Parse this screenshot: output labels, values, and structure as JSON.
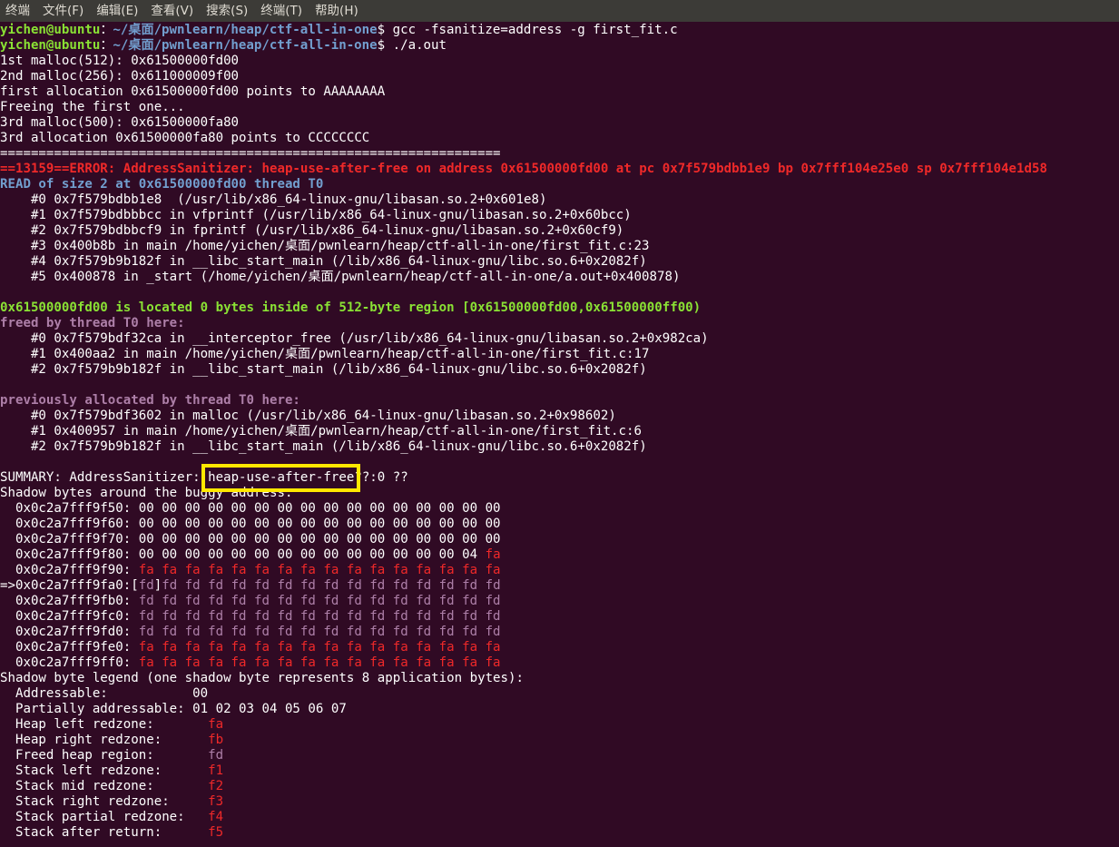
{
  "menubar": [
    "终端",
    "文件(F)",
    "编辑(E)",
    "查看(V)",
    "搜索(S)",
    "终端(T)",
    "帮助(H)"
  ],
  "colors": {
    "background": "#300a24",
    "prompt_user": "#8ae234",
    "prompt_path": "#729fcf",
    "error": "#ef2929",
    "note": "#ad7fa8",
    "highlight_box": "#ffe800"
  },
  "terminal_lines": [
    [
      [
        "g",
        "yichen@ubuntu"
      ],
      [
        "",
        "："
      ],
      [
        "b",
        "~/桌面/pwnlearn/heap/ctf-all-in-one"
      ],
      [
        "",
        "$ gcc -fsanitize=address -g first_fit.c"
      ]
    ],
    [
      [
        "g",
        "yichen@ubuntu"
      ],
      [
        "",
        "："
      ],
      [
        "b",
        "~/桌面/pwnlearn/heap/ctf-all-in-one"
      ],
      [
        "",
        "$ ./a.out"
      ]
    ],
    [
      [
        "",
        "1st malloc(512): 0x61500000fd00"
      ]
    ],
    [
      [
        "",
        "2nd malloc(256): 0x611000009f00"
      ]
    ],
    [
      [
        "",
        "first allocation 0x61500000fd00 points to AAAAAAAA"
      ]
    ],
    [
      [
        "",
        "Freeing the first one..."
      ]
    ],
    [
      [
        "",
        "3rd malloc(500): 0x61500000fa80"
      ]
    ],
    [
      [
        "",
        "3rd allocation 0x61500000fa80 points to CCCCCCCC"
      ]
    ],
    [
      [
        "",
        "================================================================="
      ]
    ],
    [
      [
        "r",
        "==13159==ERROR: AddressSanitizer: heap-use-after-free on address 0x61500000fd00 at pc 0x7f579bdbb1e9 bp 0x7fff104e25e0 sp 0x7fff104e1d58"
      ]
    ],
    [
      [
        "b",
        "READ of size 2 at 0x61500000fd00 thread T0"
      ]
    ],
    [
      [
        "",
        "    #0 0x7f579bdbb1e8  (/usr/lib/x86_64-linux-gnu/libasan.so.2+0x601e8)"
      ]
    ],
    [
      [
        "",
        "    #1 0x7f579bdbbbcc in vfprintf (/usr/lib/x86_64-linux-gnu/libasan.so.2+0x60bcc)"
      ]
    ],
    [
      [
        "",
        "    #2 0x7f579bdbbcf9 in fprintf (/usr/lib/x86_64-linux-gnu/libasan.so.2+0x60cf9)"
      ]
    ],
    [
      [
        "",
        "    #3 0x400b8b in main /home/yichen/桌面/pwnlearn/heap/ctf-all-in-one/first_fit.c:23"
      ]
    ],
    [
      [
        "",
        "    #4 0x7f579b9b182f in __libc_start_main (/lib/x86_64-linux-gnu/libc.so.6+0x2082f)"
      ]
    ],
    [
      [
        "",
        "    #5 0x400878 in _start (/home/yichen/桌面/pwnlearn/heap/ctf-all-in-one/a.out+0x400878)"
      ]
    ],
    [
      [
        "",
        ""
      ]
    ],
    [
      [
        "g",
        "0x61500000fd00 is located 0 bytes inside of 512-byte region [0x61500000fd00,0x61500000ff00)"
      ]
    ],
    [
      [
        "m",
        "freed by thread T0 here:"
      ]
    ],
    [
      [
        "",
        "    #0 0x7f579bdf32ca in __interceptor_free (/usr/lib/x86_64-linux-gnu/libasan.so.2+0x982ca)"
      ]
    ],
    [
      [
        "",
        "    #1 0x400aa2 in main /home/yichen/桌面/pwnlearn/heap/ctf-all-in-one/first_fit.c:17"
      ]
    ],
    [
      [
        "",
        "    #2 0x7f579b9b182f in __libc_start_main (/lib/x86_64-linux-gnu/libc.so.6+0x2082f)"
      ]
    ],
    [
      [
        "",
        ""
      ]
    ],
    [
      [
        "m",
        "previously allocated by thread T0 here:"
      ]
    ],
    [
      [
        "",
        "    #0 0x7f579bdf3602 in malloc (/usr/lib/x86_64-linux-gnu/libasan.so.2+0x98602)"
      ]
    ],
    [
      [
        "",
        "    #1 0x400957 in main /home/yichen/桌面/pwnlearn/heap/ctf-all-in-one/first_fit.c:6"
      ]
    ],
    [
      [
        "",
        "    #2 0x7f579b9b182f in __libc_start_main (/lib/x86_64-linux-gnu/libc.so.6+0x2082f)"
      ]
    ],
    [
      [
        "",
        ""
      ]
    ],
    [
      [
        "",
        "SUMMARY: AddressSanitizer: "
      ],
      [
        "hl",
        "heap-use-after-free"
      ],
      [
        "",
        "??:0 ??"
      ]
    ],
    [
      [
        "",
        "Shadow bytes around the buggy address:"
      ]
    ],
    [
      [
        "",
        "  0x0c2a7fff9f50: 00 00 00 00 00 00 00 00 00 00 00 00 00 00 00 00"
      ]
    ],
    [
      [
        "",
        "  0x0c2a7fff9f60: 00 00 00 00 00 00 00 00 00 00 00 00 00 00 00 00"
      ]
    ],
    [
      [
        "",
        "  0x0c2a7fff9f70: 00 00 00 00 00 00 00 00 00 00 00 00 00 00 00 00"
      ]
    ],
    [
      [
        "",
        "  0x0c2a7fff9f80: 00 00 00 00 00 00 00 00 00 00 00 00 00 00 04 "
      ],
      [
        "rr",
        "fa"
      ]
    ],
    [
      [
        "",
        "  0x0c2a7fff9f90: "
      ],
      [
        "rr",
        "fa fa fa fa fa fa fa fa fa fa fa fa fa fa fa fa"
      ]
    ],
    [
      [
        "",
        "=>0x0c2a7fff9fa0:["
      ],
      [
        "mm",
        "fd"
      ],
      [
        "",
        "]"
      ],
      [
        "mm",
        "fd fd fd fd fd fd fd fd fd fd fd fd fd fd fd"
      ]
    ],
    [
      [
        "",
        "  0x0c2a7fff9fb0: "
      ],
      [
        "mm",
        "fd fd fd fd fd fd fd fd fd fd fd fd fd fd fd fd"
      ]
    ],
    [
      [
        "",
        "  0x0c2a7fff9fc0: "
      ],
      [
        "mm",
        "fd fd fd fd fd fd fd fd fd fd fd fd fd fd fd fd"
      ]
    ],
    [
      [
        "",
        "  0x0c2a7fff9fd0: "
      ],
      [
        "mm",
        "fd fd fd fd fd fd fd fd fd fd fd fd fd fd fd fd"
      ]
    ],
    [
      [
        "",
        "  0x0c2a7fff9fe0: "
      ],
      [
        "rr",
        "fa fa fa fa fa fa fa fa fa fa fa fa fa fa fa fa"
      ]
    ],
    [
      [
        "",
        "  0x0c2a7fff9ff0: "
      ],
      [
        "rr",
        "fa fa fa fa fa fa fa fa fa fa fa fa fa fa fa fa"
      ]
    ],
    [
      [
        "",
        "Shadow byte legend (one shadow byte represents 8 application bytes):"
      ]
    ],
    [
      [
        "",
        "  Addressable:           00"
      ]
    ],
    [
      [
        "",
        "  Partially addressable: 01 02 03 04 05 06 07"
      ]
    ],
    [
      [
        "",
        "  Heap left redzone:       "
      ],
      [
        "rr",
        "fa"
      ]
    ],
    [
      [
        "",
        "  Heap right redzone:      "
      ],
      [
        "rr",
        "fb"
      ]
    ],
    [
      [
        "",
        "  Freed heap region:       "
      ],
      [
        "mm",
        "fd"
      ]
    ],
    [
      [
        "",
        "  Stack left redzone:      "
      ],
      [
        "rr",
        "f1"
      ]
    ],
    [
      [
        "",
        "  Stack mid redzone:       "
      ],
      [
        "rr",
        "f2"
      ]
    ],
    [
      [
        "",
        "  Stack right redzone:     "
      ],
      [
        "rr",
        "f3"
      ]
    ],
    [
      [
        "",
        "  Stack partial redzone:   "
      ],
      [
        "rr",
        "f4"
      ]
    ],
    [
      [
        "",
        "  Stack after return:      "
      ],
      [
        "rr",
        "f5"
      ]
    ]
  ]
}
